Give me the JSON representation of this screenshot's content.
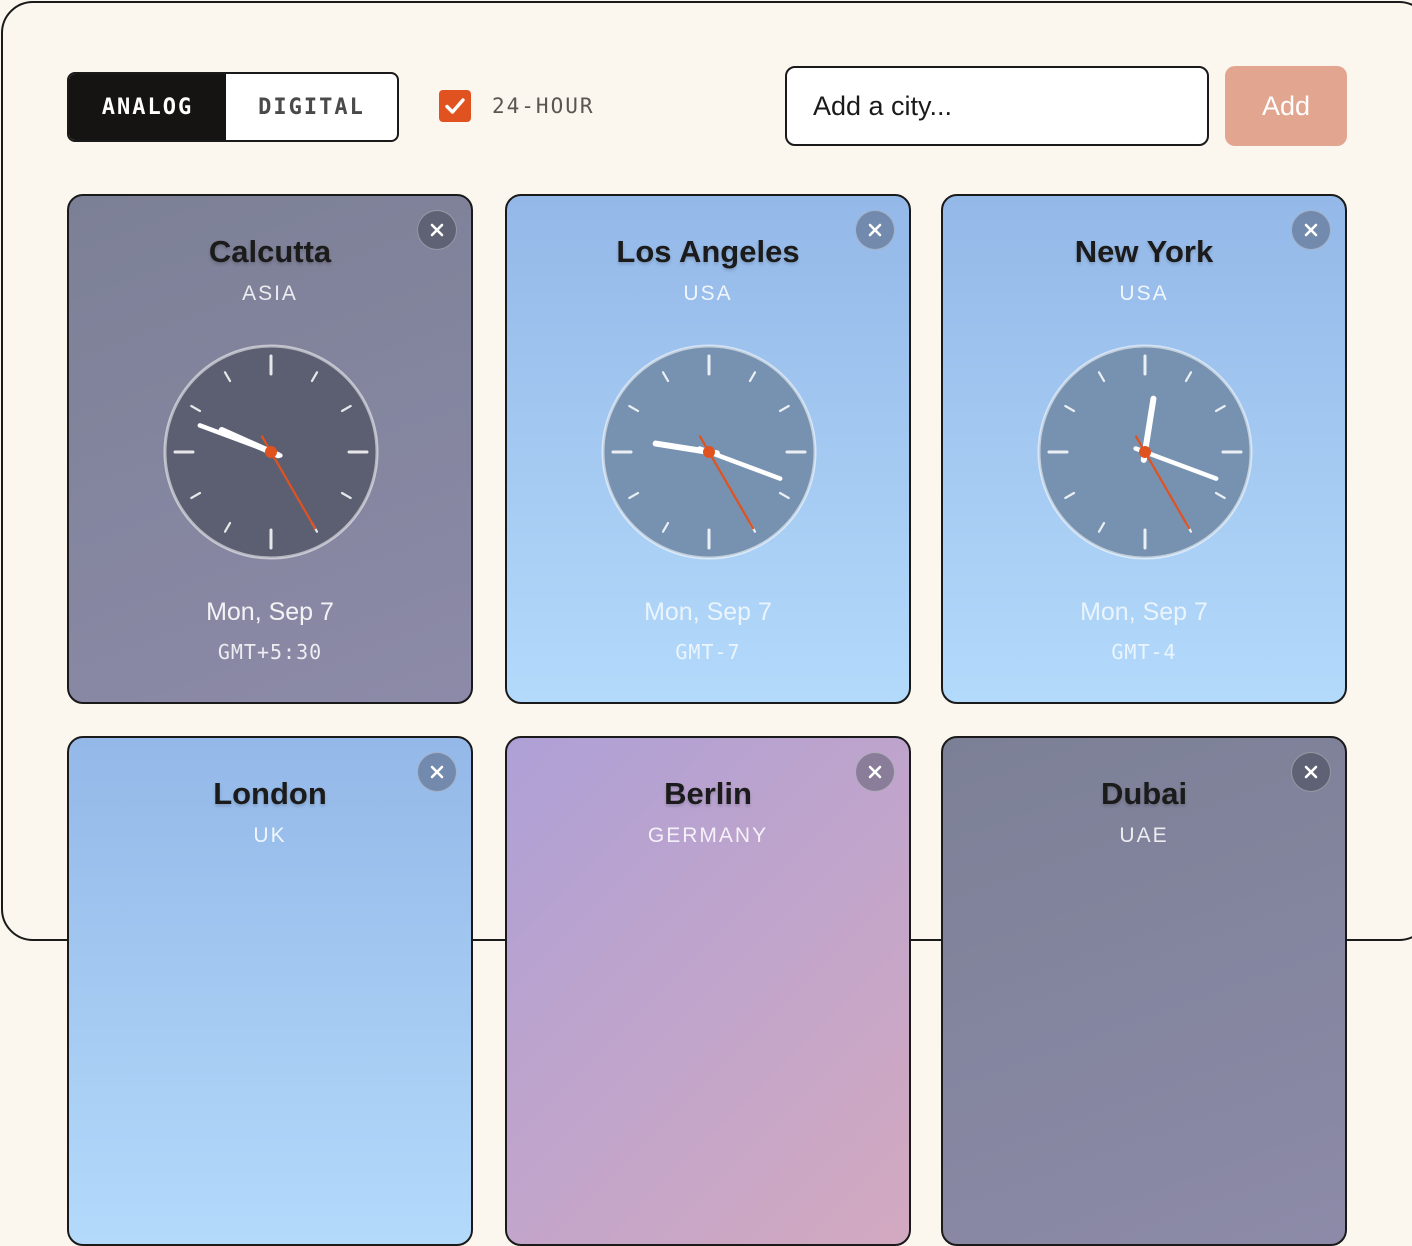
{
  "toolbar": {
    "mode_analog": "ANALOG",
    "mode_digital": "DIGITAL",
    "active_mode": "analog",
    "hour24_checked": true,
    "hour24_label": "24-HOUR",
    "city_input_placeholder": "Add a city...",
    "add_label": "Add"
  },
  "colors": {
    "accent": "#e0521f",
    "add_button": "#e2a58f",
    "dark": "#161412",
    "second_hand": "#e0521f"
  },
  "icons": {
    "close": "close-icon",
    "check": "check-icon"
  },
  "clocks": [
    {
      "city": "Calcutta",
      "region": "ASIA",
      "date": "Mon, Sep 7",
      "gmt": "GMT+5:30",
      "theme": "night",
      "time": {
        "h": 21,
        "m": 48,
        "s": 25
      }
    },
    {
      "city": "Los Angeles",
      "region": "USA",
      "date": "Mon, Sep 7",
      "gmt": "GMT-7",
      "theme": "day",
      "time": {
        "h": 9,
        "m": 18,
        "s": 25
      }
    },
    {
      "city": "New York",
      "region": "USA",
      "date": "Mon, Sep 7",
      "gmt": "GMT-4",
      "theme": "day",
      "time": {
        "h": 12,
        "m": 18,
        "s": 25
      }
    },
    {
      "city": "London",
      "region": "UK",
      "theme": "day"
    },
    {
      "city": "Berlin",
      "region": "GERMANY",
      "theme": "dusk"
    },
    {
      "city": "Dubai",
      "region": "UAE",
      "theme": "night"
    }
  ]
}
